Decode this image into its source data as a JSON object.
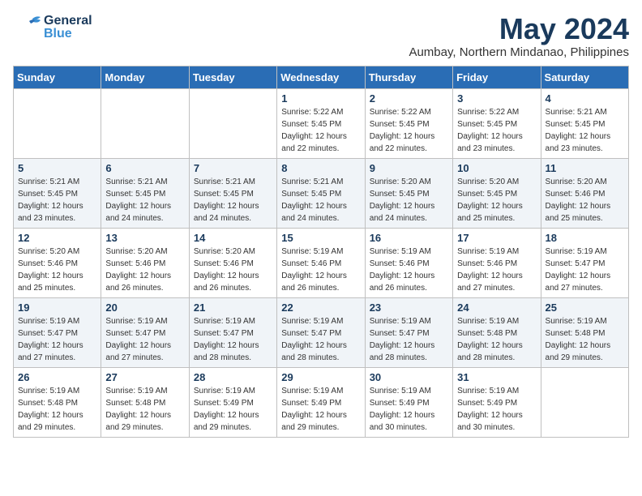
{
  "logo": {
    "general": "General",
    "blue": "Blue"
  },
  "title": "May 2024",
  "location": "Aumbay, Northern Mindanao, Philippines",
  "days_header": [
    "Sunday",
    "Monday",
    "Tuesday",
    "Wednesday",
    "Thursday",
    "Friday",
    "Saturday"
  ],
  "weeks": [
    [
      {
        "day": "",
        "sunrise": "",
        "sunset": "",
        "daylight": ""
      },
      {
        "day": "",
        "sunrise": "",
        "sunset": "",
        "daylight": ""
      },
      {
        "day": "",
        "sunrise": "",
        "sunset": "",
        "daylight": ""
      },
      {
        "day": "1",
        "sunrise": "Sunrise: 5:22 AM",
        "sunset": "Sunset: 5:45 PM",
        "daylight": "Daylight: 12 hours and 22 minutes."
      },
      {
        "day": "2",
        "sunrise": "Sunrise: 5:22 AM",
        "sunset": "Sunset: 5:45 PM",
        "daylight": "Daylight: 12 hours and 22 minutes."
      },
      {
        "day": "3",
        "sunrise": "Sunrise: 5:22 AM",
        "sunset": "Sunset: 5:45 PM",
        "daylight": "Daylight: 12 hours and 23 minutes."
      },
      {
        "day": "4",
        "sunrise": "Sunrise: 5:21 AM",
        "sunset": "Sunset: 5:45 PM",
        "daylight": "Daylight: 12 hours and 23 minutes."
      }
    ],
    [
      {
        "day": "5",
        "sunrise": "Sunrise: 5:21 AM",
        "sunset": "Sunset: 5:45 PM",
        "daylight": "Daylight: 12 hours and 23 minutes."
      },
      {
        "day": "6",
        "sunrise": "Sunrise: 5:21 AM",
        "sunset": "Sunset: 5:45 PM",
        "daylight": "Daylight: 12 hours and 24 minutes."
      },
      {
        "day": "7",
        "sunrise": "Sunrise: 5:21 AM",
        "sunset": "Sunset: 5:45 PM",
        "daylight": "Daylight: 12 hours and 24 minutes."
      },
      {
        "day": "8",
        "sunrise": "Sunrise: 5:21 AM",
        "sunset": "Sunset: 5:45 PM",
        "daylight": "Daylight: 12 hours and 24 minutes."
      },
      {
        "day": "9",
        "sunrise": "Sunrise: 5:20 AM",
        "sunset": "Sunset: 5:45 PM",
        "daylight": "Daylight: 12 hours and 24 minutes."
      },
      {
        "day": "10",
        "sunrise": "Sunrise: 5:20 AM",
        "sunset": "Sunset: 5:45 PM",
        "daylight": "Daylight: 12 hours and 25 minutes."
      },
      {
        "day": "11",
        "sunrise": "Sunrise: 5:20 AM",
        "sunset": "Sunset: 5:46 PM",
        "daylight": "Daylight: 12 hours and 25 minutes."
      }
    ],
    [
      {
        "day": "12",
        "sunrise": "Sunrise: 5:20 AM",
        "sunset": "Sunset: 5:46 PM",
        "daylight": "Daylight: 12 hours and 25 minutes."
      },
      {
        "day": "13",
        "sunrise": "Sunrise: 5:20 AM",
        "sunset": "Sunset: 5:46 PM",
        "daylight": "Daylight: 12 hours and 26 minutes."
      },
      {
        "day": "14",
        "sunrise": "Sunrise: 5:20 AM",
        "sunset": "Sunset: 5:46 PM",
        "daylight": "Daylight: 12 hours and 26 minutes."
      },
      {
        "day": "15",
        "sunrise": "Sunrise: 5:19 AM",
        "sunset": "Sunset: 5:46 PM",
        "daylight": "Daylight: 12 hours and 26 minutes."
      },
      {
        "day": "16",
        "sunrise": "Sunrise: 5:19 AM",
        "sunset": "Sunset: 5:46 PM",
        "daylight": "Daylight: 12 hours and 26 minutes."
      },
      {
        "day": "17",
        "sunrise": "Sunrise: 5:19 AM",
        "sunset": "Sunset: 5:46 PM",
        "daylight": "Daylight: 12 hours and 27 minutes."
      },
      {
        "day": "18",
        "sunrise": "Sunrise: 5:19 AM",
        "sunset": "Sunset: 5:47 PM",
        "daylight": "Daylight: 12 hours and 27 minutes."
      }
    ],
    [
      {
        "day": "19",
        "sunrise": "Sunrise: 5:19 AM",
        "sunset": "Sunset: 5:47 PM",
        "daylight": "Daylight: 12 hours and 27 minutes."
      },
      {
        "day": "20",
        "sunrise": "Sunrise: 5:19 AM",
        "sunset": "Sunset: 5:47 PM",
        "daylight": "Daylight: 12 hours and 27 minutes."
      },
      {
        "day": "21",
        "sunrise": "Sunrise: 5:19 AM",
        "sunset": "Sunset: 5:47 PM",
        "daylight": "Daylight: 12 hours and 28 minutes."
      },
      {
        "day": "22",
        "sunrise": "Sunrise: 5:19 AM",
        "sunset": "Sunset: 5:47 PM",
        "daylight": "Daylight: 12 hours and 28 minutes."
      },
      {
        "day": "23",
        "sunrise": "Sunrise: 5:19 AM",
        "sunset": "Sunset: 5:47 PM",
        "daylight": "Daylight: 12 hours and 28 minutes."
      },
      {
        "day": "24",
        "sunrise": "Sunrise: 5:19 AM",
        "sunset": "Sunset: 5:48 PM",
        "daylight": "Daylight: 12 hours and 28 minutes."
      },
      {
        "day": "25",
        "sunrise": "Sunrise: 5:19 AM",
        "sunset": "Sunset: 5:48 PM",
        "daylight": "Daylight: 12 hours and 29 minutes."
      }
    ],
    [
      {
        "day": "26",
        "sunrise": "Sunrise: 5:19 AM",
        "sunset": "Sunset: 5:48 PM",
        "daylight": "Daylight: 12 hours and 29 minutes."
      },
      {
        "day": "27",
        "sunrise": "Sunrise: 5:19 AM",
        "sunset": "Sunset: 5:48 PM",
        "daylight": "Daylight: 12 hours and 29 minutes."
      },
      {
        "day": "28",
        "sunrise": "Sunrise: 5:19 AM",
        "sunset": "Sunset: 5:49 PM",
        "daylight": "Daylight: 12 hours and 29 minutes."
      },
      {
        "day": "29",
        "sunrise": "Sunrise: 5:19 AM",
        "sunset": "Sunset: 5:49 PM",
        "daylight": "Daylight: 12 hours and 29 minutes."
      },
      {
        "day": "30",
        "sunrise": "Sunrise: 5:19 AM",
        "sunset": "Sunset: 5:49 PM",
        "daylight": "Daylight: 12 hours and 30 minutes."
      },
      {
        "day": "31",
        "sunrise": "Sunrise: 5:19 AM",
        "sunset": "Sunset: 5:49 PM",
        "daylight": "Daylight: 12 hours and 30 minutes."
      },
      {
        "day": "",
        "sunrise": "",
        "sunset": "",
        "daylight": ""
      }
    ]
  ]
}
